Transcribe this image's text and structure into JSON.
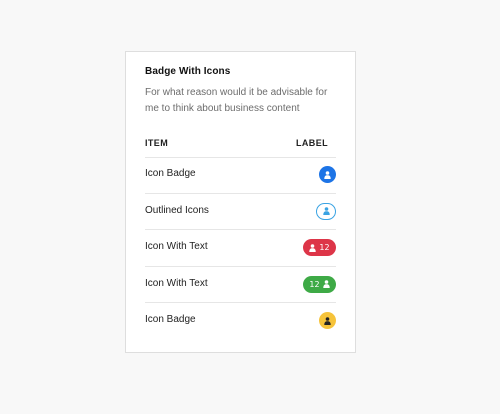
{
  "card": {
    "title": "Badge With Icons",
    "description": "For what reason would it be advisable for me to think about business content"
  },
  "table": {
    "headers": {
      "item": "ITEM",
      "label": "LABEL"
    },
    "rows": [
      {
        "text": "Icon Badge",
        "badge": {
          "style": "solid-round",
          "color": "#1d74e6",
          "icon": "user-icon",
          "count": ""
        }
      },
      {
        "text": "Outlined Icons",
        "badge": {
          "style": "outline",
          "color": "#3aa3e3",
          "icon": "user-icon",
          "count": ""
        }
      },
      {
        "text": "Icon With Text",
        "badge": {
          "style": "pill-icon-first",
          "color": "#dd3548",
          "icon": "user-icon",
          "count": "12"
        }
      },
      {
        "text": "Icon With Text",
        "badge": {
          "style": "pill-text-first",
          "color": "#3eaa46",
          "icon": "user-icon",
          "count": "12"
        }
      },
      {
        "text": "Icon Badge",
        "badge": {
          "style": "solid-round",
          "color": "#f6c33a",
          "icon": "user-icon",
          "count": ""
        }
      }
    ]
  }
}
